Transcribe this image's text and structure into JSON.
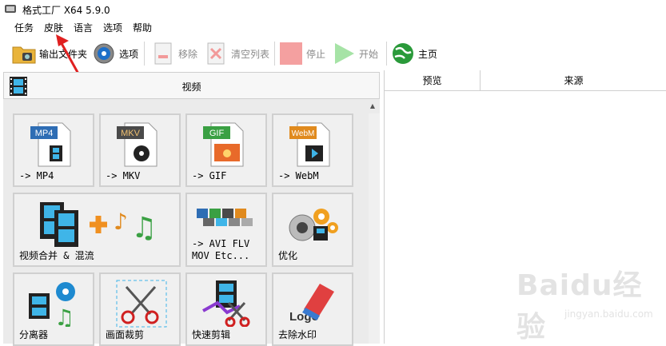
{
  "window": {
    "title": "格式工厂 X64 5.9.0"
  },
  "menu": [
    "任务",
    "皮肤",
    "语言",
    "选项",
    "帮助"
  ],
  "toolbar": {
    "output_folder": "输出文件夹",
    "options": "选项",
    "remove": "移除",
    "clear_list": "清空列表",
    "stop": "停止",
    "start": "开始",
    "home": "主页"
  },
  "category": {
    "label": "视频"
  },
  "tiles": [
    {
      "label": "-> MP4",
      "badge": "MP4",
      "badge_color": "#2e6db4"
    },
    {
      "label": "-> MKV",
      "badge": "MKV",
      "badge_color": "#4a4a4a"
    },
    {
      "label": "-> GIF",
      "badge": "GIF",
      "badge_color": "#3aa043"
    },
    {
      "label": "-> WebM",
      "badge": "WebM",
      "badge_color": "#e08a1e"
    },
    {
      "label": "视频合并 & 混流"
    },
    {
      "label": "-> AVI FLV\nMOV Etc..."
    },
    {
      "label": "优化"
    },
    {
      "label": "分离器"
    },
    {
      "label": "画面裁剪"
    },
    {
      "label": "快速剪辑"
    },
    {
      "label": "去除水印",
      "logo_text": "Logo"
    }
  ],
  "table": {
    "col_preview": "预览",
    "col_source": "来源"
  },
  "watermark": {
    "brand": "Baidu经验",
    "url": "jingyan.baidu.com"
  },
  "colors": {
    "accent_red": "#e02020",
    "panel_bg": "#ebebeb",
    "tile_bg": "#f0f0f0"
  }
}
